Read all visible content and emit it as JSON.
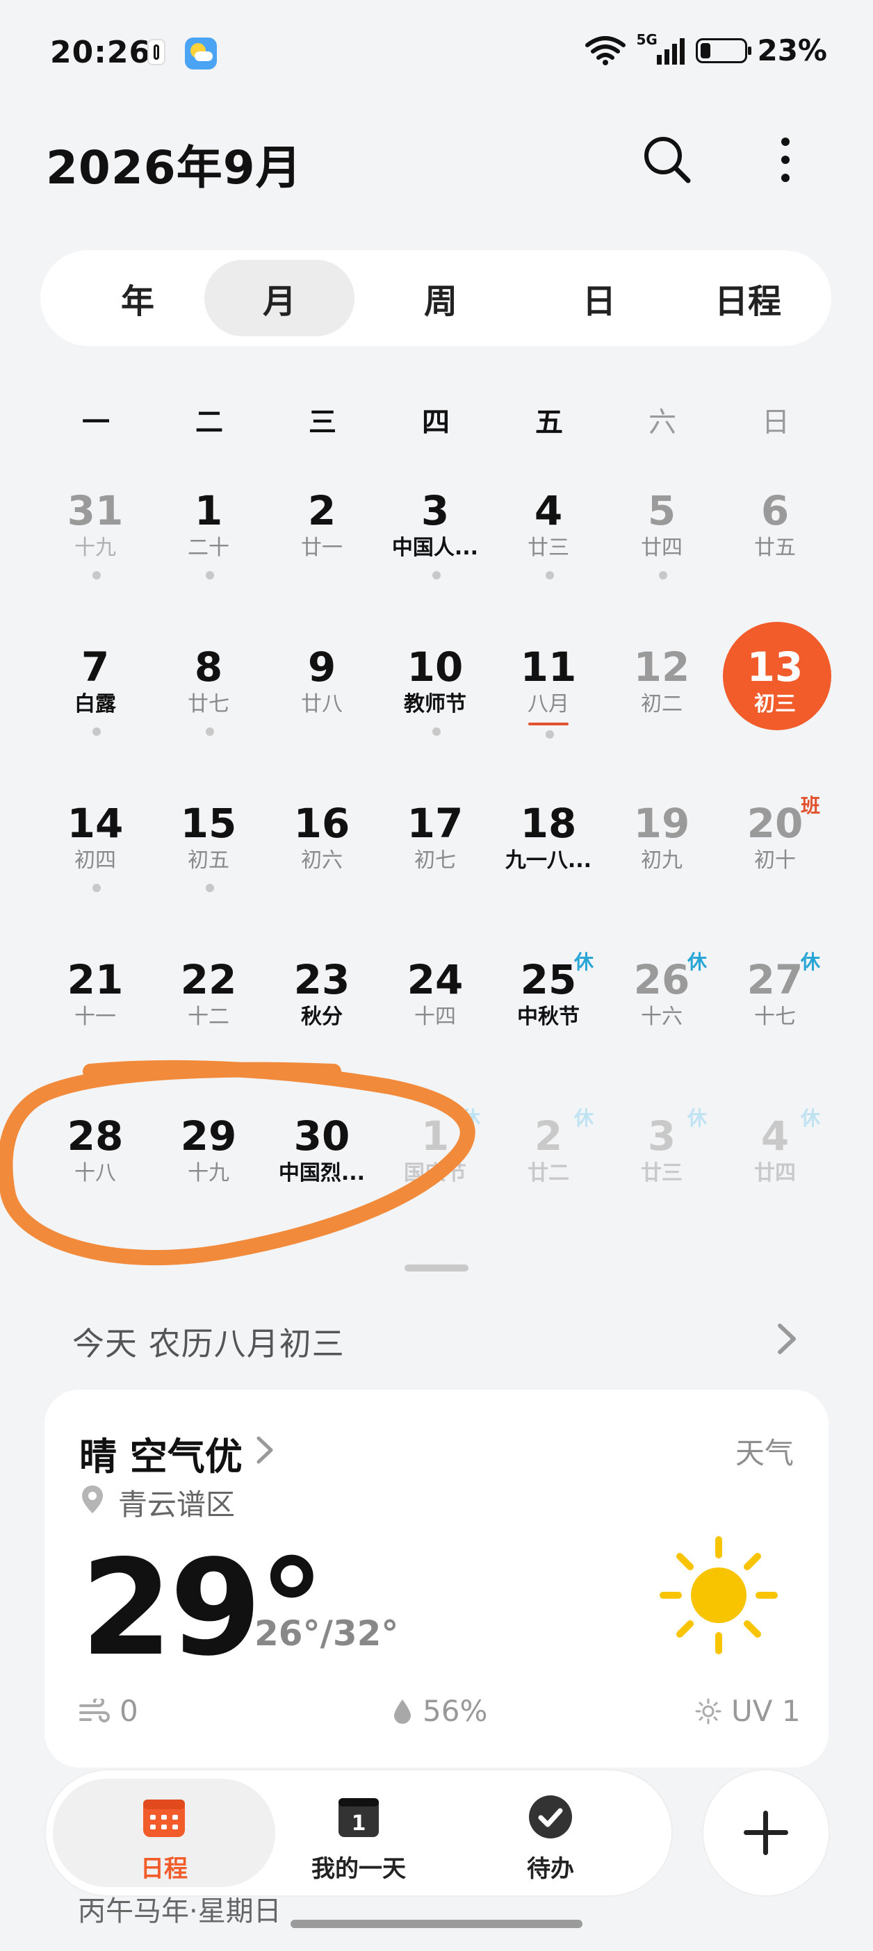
{
  "status_bar": {
    "time": "20:26",
    "network": "5G",
    "battery_pct": "23%",
    "battery_level": 0.23
  },
  "header": {
    "title": "2026年9月"
  },
  "view_tabs": [
    {
      "label": "年",
      "active": false
    },
    {
      "label": "月",
      "active": true
    },
    {
      "label": "周",
      "active": false
    },
    {
      "label": "日",
      "active": false
    },
    {
      "label": "日程",
      "active": false
    }
  ],
  "weekdays": [
    "一",
    "二",
    "三",
    "四",
    "五",
    "六",
    "日"
  ],
  "calendar": {
    "weeks": [
      [
        {
          "day": "31",
          "lunar": "十九",
          "dim": true,
          "dot": true
        },
        {
          "day": "1",
          "lunar": "二十",
          "dot": true
        },
        {
          "day": "2",
          "lunar": "廿一"
        },
        {
          "day": "3",
          "lunar": "中国人...",
          "special": true,
          "dot": true
        },
        {
          "day": "4",
          "lunar": "廿三",
          "dot": true
        },
        {
          "day": "5",
          "lunar": "廿四",
          "dot": true
        },
        {
          "day": "6",
          "lunar": "廿五"
        }
      ],
      [
        {
          "day": "7",
          "lunar": "白露",
          "special": true,
          "dot": true
        },
        {
          "day": "8",
          "lunar": "廿七",
          "dot": true
        },
        {
          "day": "9",
          "lunar": "廿八"
        },
        {
          "day": "10",
          "lunar": "教师节",
          "special": true,
          "dot": true
        },
        {
          "day": "11",
          "lunar": "八月",
          "dot": true,
          "underline": true
        },
        {
          "day": "12",
          "lunar": "初二"
        },
        {
          "day": "13",
          "lunar": "初三",
          "today": true
        }
      ],
      [
        {
          "day": "14",
          "lunar": "初四",
          "dot": true
        },
        {
          "day": "15",
          "lunar": "初五",
          "dot": true
        },
        {
          "day": "16",
          "lunar": "初六"
        },
        {
          "day": "17",
          "lunar": "初七"
        },
        {
          "day": "18",
          "lunar": "九一八...",
          "special": true
        },
        {
          "day": "19",
          "lunar": "初九"
        },
        {
          "day": "20",
          "lunar": "初十",
          "badge": "班"
        }
      ],
      [
        {
          "day": "21",
          "lunar": "十一"
        },
        {
          "day": "22",
          "lunar": "十二"
        },
        {
          "day": "23",
          "lunar": "秋分",
          "special": true
        },
        {
          "day": "24",
          "lunar": "十四"
        },
        {
          "day": "25",
          "lunar": "中秋节",
          "special": true,
          "badge": "休"
        },
        {
          "day": "26",
          "lunar": "十六",
          "badge": "休"
        },
        {
          "day": "27",
          "lunar": "十七",
          "badge": "休"
        }
      ],
      [
        {
          "day": "28",
          "lunar": "十八"
        },
        {
          "day": "29",
          "lunar": "十九"
        },
        {
          "day": "30",
          "lunar": "中国烈...",
          "special": true
        },
        {
          "day": "1",
          "lunar": "国庆节",
          "faded": true,
          "badge": "休"
        },
        {
          "day": "2",
          "lunar": "廿二",
          "faded": true,
          "badge": "休"
        },
        {
          "day": "3",
          "lunar": "廿三",
          "faded": true,
          "badge": "休"
        },
        {
          "day": "4",
          "lunar": "廿四",
          "faded": true,
          "badge": "休"
        }
      ]
    ]
  },
  "today_line": "今天 农历八月初三",
  "weather": {
    "condition": "晴 空气优",
    "link": "天气",
    "location": "青云谱区",
    "temp": "29°",
    "range": "26°/32°",
    "wind": "0",
    "humidity": "56%",
    "uv": "UV 1",
    "icon": "sun-icon"
  },
  "bottom_nav": [
    {
      "label": "日程",
      "icon": "calendar-icon",
      "active": true
    },
    {
      "label": "我的一天",
      "icon": "day-page-icon",
      "active": false
    },
    {
      "label": "待办",
      "icon": "check-circle-icon",
      "active": false
    }
  ],
  "below_card": {
    "text": "丙午马年·星期日"
  },
  "colors": {
    "accent": "#f25c2b",
    "holiday_badge": "#2aa6d6",
    "annotation": "#f28a3c",
    "background": "#f3f4f6"
  }
}
